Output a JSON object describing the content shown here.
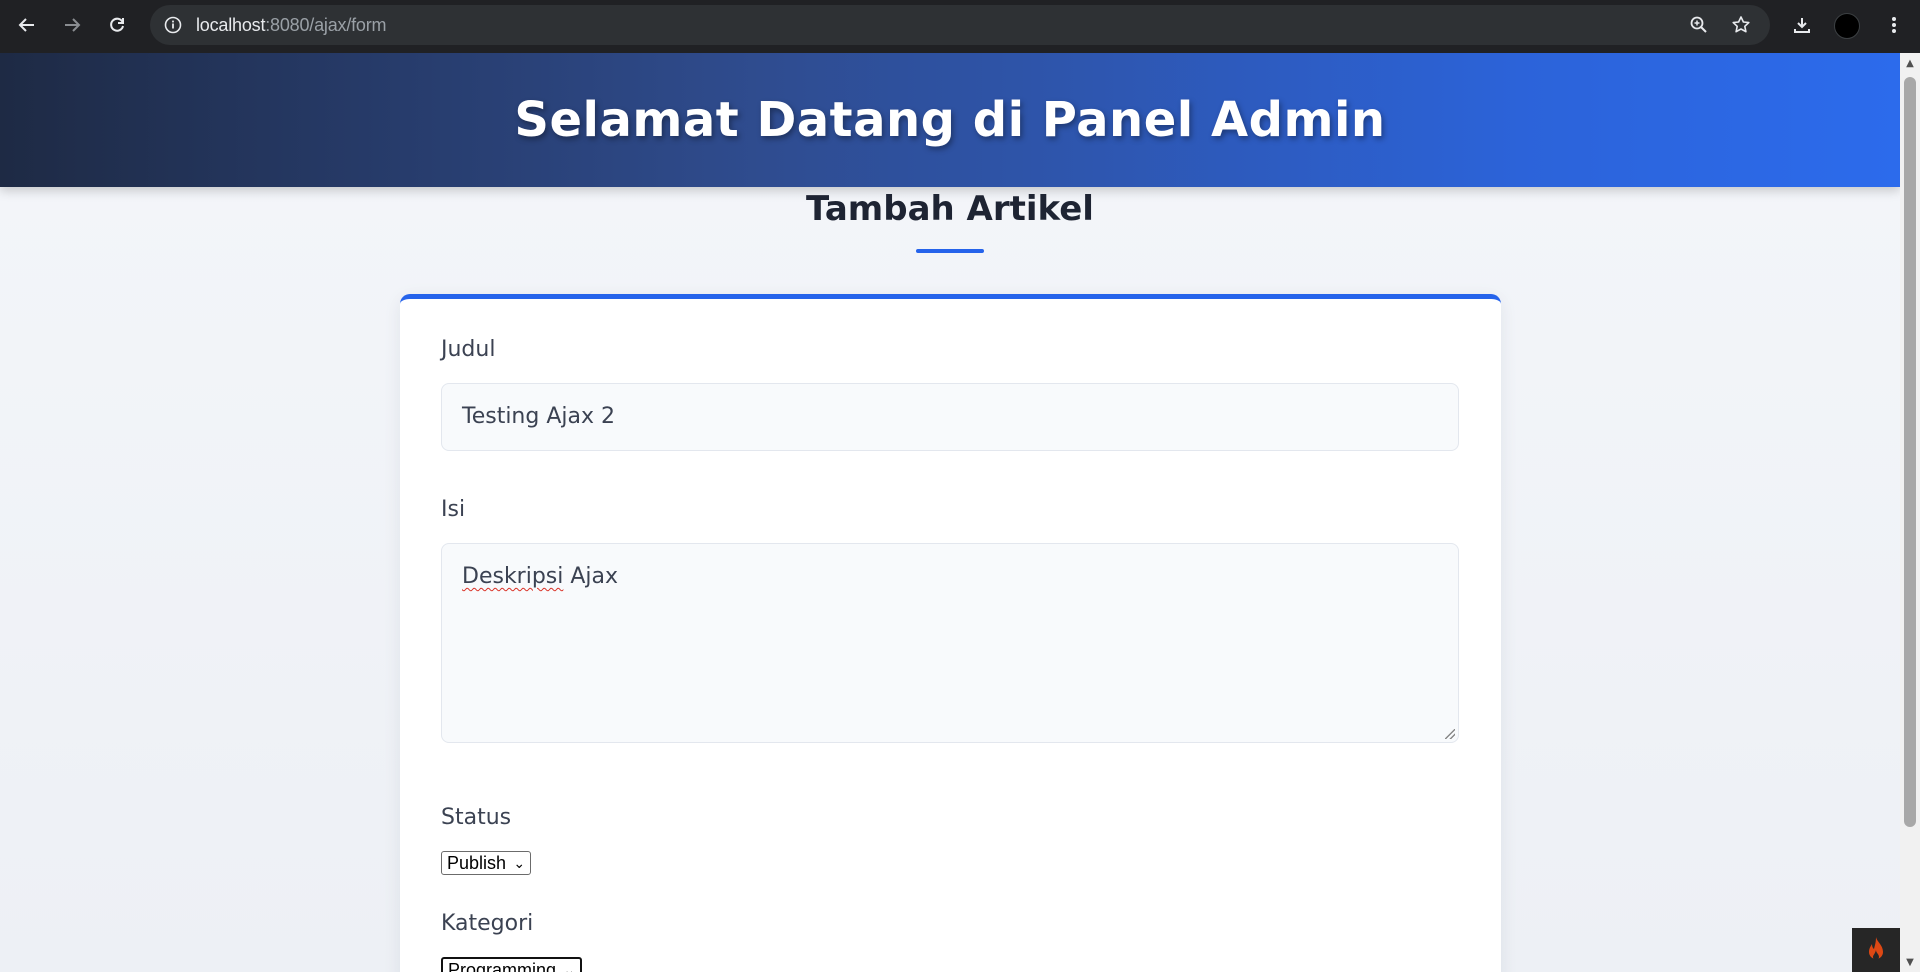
{
  "browser": {
    "url_host": "localhost",
    "url_path": ":8080/ajax/form",
    "icons": [
      "back-arrow-icon",
      "forward-arrow-icon",
      "reload-icon",
      "site-info-icon",
      "zoom-icon",
      "bookmark-star-icon",
      "download-icon",
      "profile-avatar",
      "more-menu-icon"
    ]
  },
  "header": {
    "title": "Selamat Datang di Panel Admin"
  },
  "page": {
    "section_title": "Tambah Artikel"
  },
  "form": {
    "judul_label": "Judul",
    "judul_value": "Testing Ajax 2",
    "isi_label": "Isi",
    "isi_word1": "Deskripsi",
    "isi_word2": " Ajax",
    "status_label": "Status",
    "status_value": "Publish",
    "kategori_label": "Kategori",
    "kategori_value": "Programming"
  },
  "colors": {
    "accent": "#2563eb",
    "header_start": "#1e2a44",
    "header_end": "#2c6bec",
    "debug_flame": "#dd4814"
  }
}
